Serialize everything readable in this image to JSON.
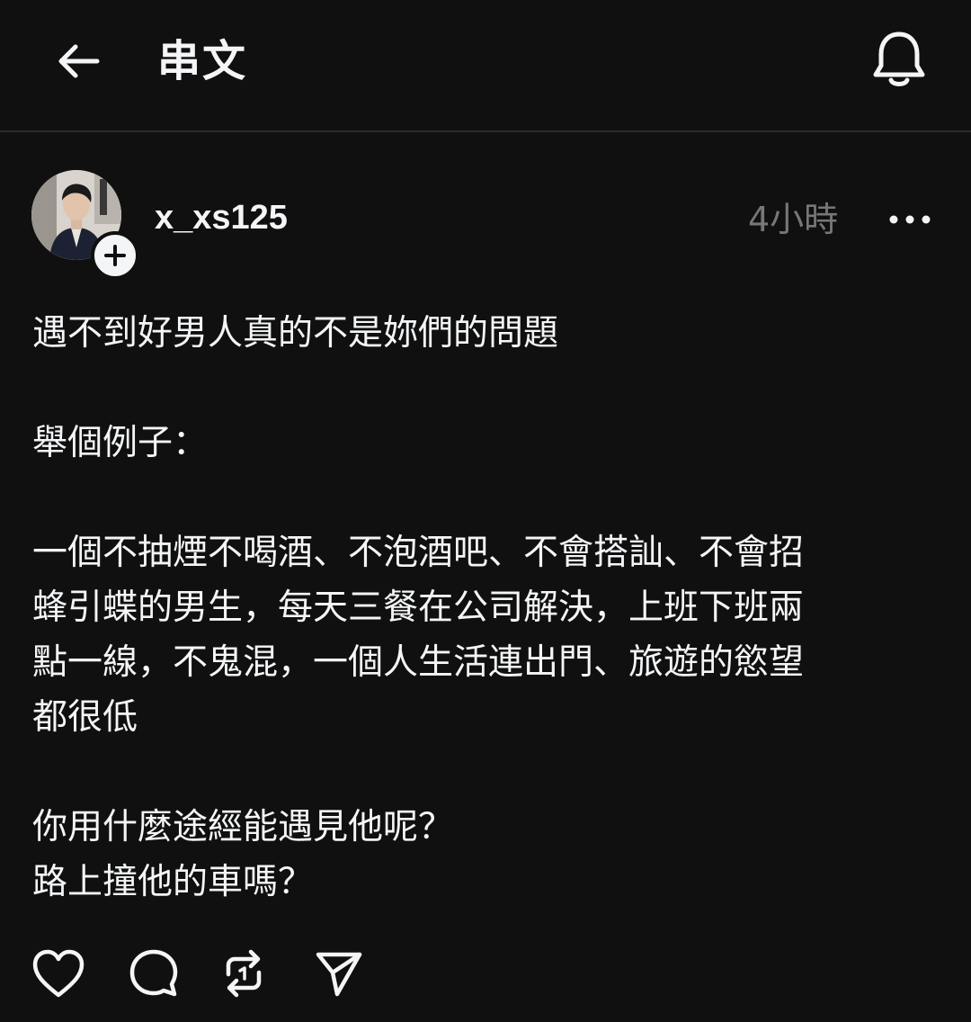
{
  "header": {
    "title": "串文",
    "back_icon": "arrow-left-icon",
    "notify_icon": "bell-icon"
  },
  "post": {
    "username": "x_xs125",
    "timestamp": "4小時",
    "avatar_icon": "profile-photo",
    "follow_icon": "plus-icon",
    "more_icon": "more-horizontal-icon",
    "paragraphs": [
      "遇不到好男人真的不是妳們的問題",
      "舉個例子：",
      "一個不抽煙不喝酒、不泡酒吧、不會搭訕、不會招\n蜂引蝶的男生，每天三餐在公司解決，上班下班兩\n點一線，不鬼混，一個人生活連出門、旅遊的慾望\n都很低",
      "你用什麼途經能遇見他呢？\n路上撞他的車嗎？"
    ],
    "actions": {
      "like_icon": "heart-icon",
      "reply_icon": "comment-icon",
      "repost_icon": "repost-icon",
      "share_icon": "send-icon"
    }
  },
  "colors": {
    "background": "#101010",
    "text": "#f3f5f7",
    "muted": "#777777",
    "divider": "#2a2a2a"
  }
}
